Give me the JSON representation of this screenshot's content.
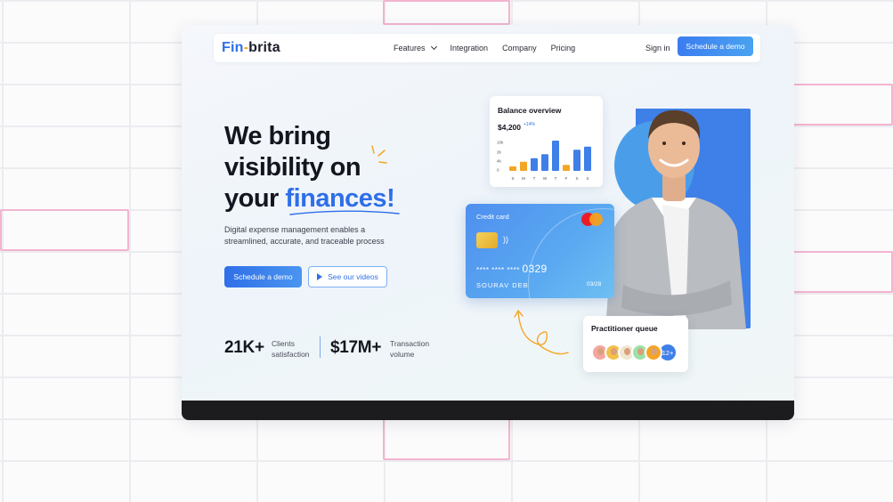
{
  "nav": {
    "logo_part1": "Fin",
    "logo_dash": "-",
    "logo_part2": "brita",
    "links": [
      "Features",
      "Integration",
      "Company",
      "Pricing"
    ],
    "signin": "Sign in",
    "cta": "Schedule a demo"
  },
  "hero": {
    "title_line1": "We bring",
    "title_line2": "visibility on",
    "title_line3_a": "your ",
    "title_line3_b": "finances!",
    "subtitle": "Digital expense management enables a streamlined, accurate, and traceable process",
    "primary_button": "Schedule a demo",
    "secondary_button": "See our videos"
  },
  "stats": [
    {
      "value": "21K+",
      "label_line1": "Clients",
      "label_line2": "satisfaction"
    },
    {
      "value": "$17M+",
      "label_line1": "Transaction",
      "label_line2": "volume"
    }
  ],
  "balance": {
    "title": "Balance overview",
    "amount": "$4,200",
    "change": "+14%",
    "yticks": [
      "10k",
      "2k",
      "4k",
      "0"
    ],
    "days": [
      "S",
      "M",
      "T",
      "W",
      "T",
      "F",
      "S",
      "S"
    ],
    "bar_levels": [
      0.15,
      0.3,
      0.42,
      0.55,
      1.0,
      0.2,
      0.7,
      0.8
    ],
    "bar_colors": [
      "#f5a524",
      "#f5a524",
      "#3f7fe8",
      "#3f7fe8",
      "#3f7fe8",
      "#f5a524",
      "#3f7fe8",
      "#3f7fe8"
    ]
  },
  "card": {
    "title": "Credit card",
    "number_masked": "**** **** ****",
    "number_last": "0329",
    "holder": "SOURAV DEB",
    "expiry": "03/28"
  },
  "queue": {
    "title": "Practitioner queue",
    "more": "12+",
    "avatar_colors": [
      "#f4a6a0",
      "#f5c04a",
      "#f0e6d2",
      "#9ee0a8",
      "#f5a524"
    ]
  },
  "colors": {
    "accent": "#2f6fe8",
    "orange": "#f5a524"
  }
}
